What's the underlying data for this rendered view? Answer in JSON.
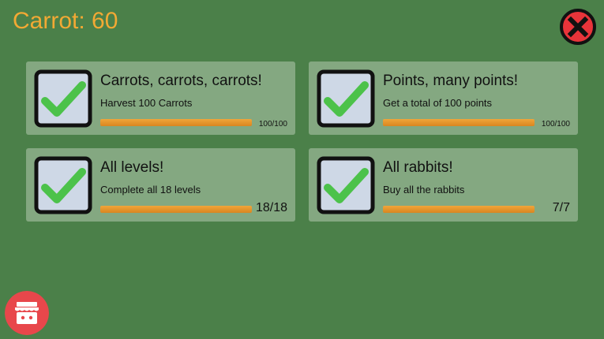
{
  "header": {
    "carrot_label": "Carrot: 60",
    "carrot_color": "#f2a934"
  },
  "achievements": [
    {
      "title": "Carrots, carrots, carrots!",
      "description": "Harvest 100 Carrots",
      "progress_text": "100/100",
      "progress": 1.0,
      "completed": true
    },
    {
      "title": "Points, many points!",
      "description": "Get a total of 100 points",
      "progress_text": "100/100",
      "progress": 1.0,
      "completed": true
    },
    {
      "title": "All levels!",
      "description": "Complete all 18 levels",
      "progress_text": "18/18",
      "progress": 1.0,
      "completed": true
    },
    {
      "title": "All rabbits!",
      "description": "Buy all the rabbits",
      "progress_text": "7/7",
      "progress": 1.0,
      "completed": true
    }
  ],
  "icons": {
    "close": "close-icon",
    "check": "checkmark-icon",
    "shop": "shop-icon"
  },
  "colors": {
    "background": "#4b8049",
    "card": "#84a881",
    "close_button": "#e8343a",
    "shop_button": "#e8474b",
    "progress": "#f0a53a",
    "check": "#4cc24a"
  }
}
